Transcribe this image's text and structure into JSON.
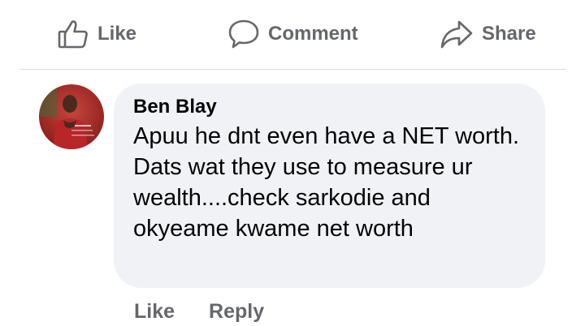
{
  "actions": {
    "like_label": "Like",
    "comment_label": "Comment",
    "share_label": "Share"
  },
  "comment": {
    "author": "Ben Blay",
    "text": "Apuu he dnt even have a NET worth. Dats wat they use to measure ur wealth....check sarkodie and okyeame kwame net worth",
    "like_label": "Like",
    "reply_label": "Reply"
  },
  "colors": {
    "action_gray": "#65676b",
    "bubble_bg": "#f0f2f5",
    "divider": "#dadde1",
    "text": "#050505"
  },
  "icons": [
    "thumbs-up-icon",
    "speech-bubble-icon",
    "share-arrow-icon"
  ]
}
